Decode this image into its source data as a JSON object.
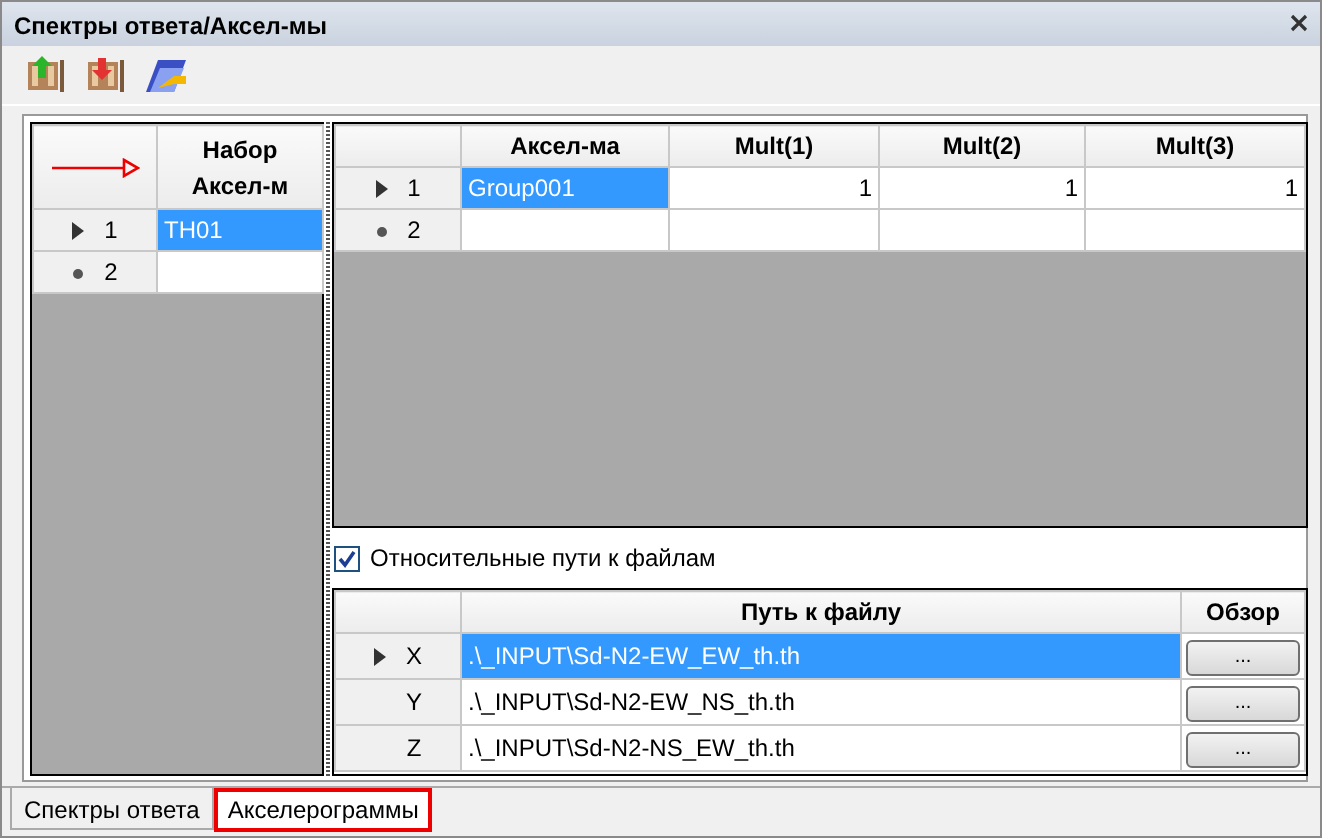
{
  "window": {
    "title": "Спектры ответа/Аксел-мы"
  },
  "toolbar": [
    {
      "kind": "add"
    },
    {
      "kind": "remove"
    },
    {
      "kind": "open"
    }
  ],
  "sets_grid": {
    "columns": [
      "Набор Аксел-м"
    ],
    "rows": [
      {
        "number": "1",
        "kind": "current",
        "cells": [
          {
            "text": "TH01",
            "selected": true
          }
        ]
      },
      {
        "number": "2",
        "kind": "new",
        "cells": [
          {
            "text": "",
            "selected": false
          }
        ]
      }
    ]
  },
  "accel_grid": {
    "columns": [
      "Аксел-ма",
      "Mult(1)",
      "Mult(2)",
      "Mult(3)"
    ],
    "rows": [
      {
        "number": "1",
        "kind": "current",
        "cells": [
          {
            "text": "Group001",
            "selected": true
          },
          {
            "text": "1",
            "selected": false
          },
          {
            "text": "1",
            "selected": false
          },
          {
            "text": "1",
            "selected": false
          }
        ]
      },
      {
        "number": "2",
        "kind": "new",
        "cells": [
          {
            "text": "",
            "selected": false
          },
          {
            "text": "",
            "selected": false
          },
          {
            "text": "",
            "selected": false
          },
          {
            "text": "",
            "selected": false
          }
        ]
      }
    ]
  },
  "relative_paths": {
    "label": "Относительные пути к файлам",
    "checked": true
  },
  "files_grid": {
    "columns": [
      "Путь к файлу",
      "Обзор"
    ],
    "rows": [
      {
        "number": "X",
        "kind": "current",
        "path": ".\\_INPUT\\Sd-N2-EW_EW_th.th",
        "selected": true,
        "button": "..."
      },
      {
        "number": "Y",
        "kind": "plain",
        "path": ".\\_INPUT\\Sd-N2-EW_NS_th.th",
        "selected": false,
        "button": "..."
      },
      {
        "number": "Z",
        "kind": "plain",
        "path": ".\\_INPUT\\Sd-N2-NS_EW_th.th",
        "selected": false,
        "button": "..."
      }
    ]
  },
  "tabs": [
    {
      "label": "Спектры ответа",
      "selected": false
    },
    {
      "label": "Акселерограммы",
      "selected": true
    }
  ]
}
